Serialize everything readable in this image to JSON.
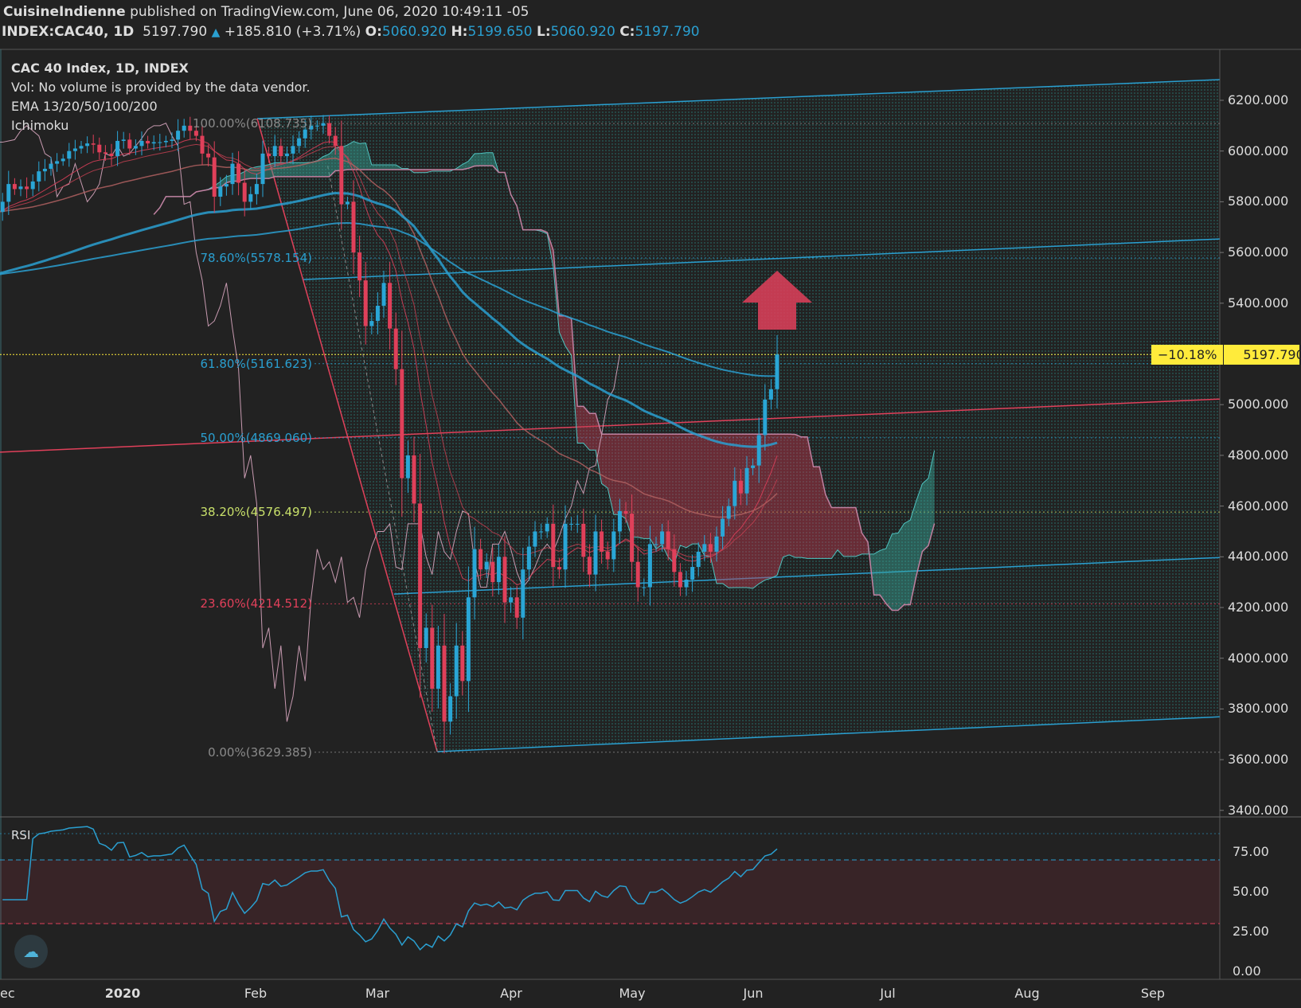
{
  "header": {
    "author": "CuisineIndienne",
    "published": " published on TradingView.com, June 06, 2020 10:49:11 -05",
    "symbol": "INDEX:CAC40, 1D",
    "last": "5197.790",
    "change": "+185.810 (+3.71%)",
    "o_label": "O:",
    "o": "5060.920",
    "h_label": "H:",
    "h": "5199.650",
    "l_label": "L:",
    "l": "5060.920",
    "c_label": "C:",
    "c": "5197.790"
  },
  "legend": [
    "CAC 40 Index, 1D, INDEX",
    "Vol: No volume is provided by the data vendor.",
    "EMA 13/20/50/100/200",
    "Ichimoku"
  ],
  "price_tag": {
    "pct": "−10.18%",
    "price": "5197.790"
  },
  "rsi_label": "RSI",
  "colors": {
    "up": "#2aa6d6",
    "down": "#e0405a",
    "bg": "#222222",
    "tag": "#ffeb3b"
  },
  "chart_data": {
    "type": "candlestick",
    "title": "CAC 40 Index, 1D, INDEX",
    "price_ticks": [
      "6200.000",
      "6000.000",
      "5800.000",
      "5600.000",
      "5400.000",
      "5200.000",
      "5000.000",
      "4800.000",
      "4600.000",
      "4400.000",
      "4200.000",
      "4000.000",
      "3800.000",
      "3600.000",
      "3400.000"
    ],
    "price_range": [
      3400,
      6200
    ],
    "rsi_ticks": [
      "75.00",
      "50.00",
      "25.00",
      "0.00"
    ],
    "rsi_bands": [
      30,
      70
    ],
    "time_ticks": [
      "ec",
      "2020",
      "Feb",
      "Mar",
      "Apr",
      "May",
      "Jun",
      "Jul",
      "Aug",
      "Sep"
    ],
    "fib_levels": [
      {
        "label": "100.00%(6108.735)",
        "value": 6108.735,
        "color": "#8a8a8a"
      },
      {
        "label": "78.60%(5578.154)",
        "value": 5578.154,
        "color": "#2a9fd0"
      },
      {
        "label": "61.80%(5161.623)",
        "value": 5161.623,
        "color": "#2a9fd0"
      },
      {
        "label": "50.00%(4869.060)",
        "value": 4869.06,
        "color": "#2a9fd0"
      },
      {
        "label": "38.20%(4576.497)",
        "value": 4576.497,
        "color": "#c8e06a"
      },
      {
        "label": "23.60%(4214.512)",
        "value": 4214.512,
        "color": "#e0405a"
      },
      {
        "label": "0.00%(3629.385)",
        "value": 3629.385,
        "color": "#8a8a8a"
      }
    ],
    "closes": [
      5760,
      5800,
      5870,
      5850,
      5860,
      5850,
      5880,
      5920,
      5930,
      5950,
      5960,
      5970,
      6000,
      6010,
      6020,
      6030,
      6025,
      5995,
      5990,
      5980,
      6040,
      6045,
      6010,
      6020,
      6040,
      6030,
      6035,
      6035,
      6040,
      6045,
      6080,
      6100,
      6080,
      6060,
      5990,
      5975,
      5820,
      5860,
      5870,
      5950,
      5875,
      5800,
      5830,
      5870,
      5990,
      5980,
      6020,
      5980,
      5990,
      6020,
      6050,
      6085,
      6100,
      6100,
      6110,
      6060,
      6020,
      5790,
      5800,
      5600,
      5490,
      5310,
      5330,
      5390,
      5480,
      5300,
      5140,
      4710,
      4800,
      4610,
      4040,
      4120,
      3880,
      4050,
      3750,
      3850,
      4050,
      3910,
      4240,
      4430,
      4350,
      4380,
      4300,
      4400,
      4220,
      4240,
      4160,
      4350,
      4440,
      4500,
      4500,
      4530,
      4360,
      4350,
      4530,
      4530,
      4530,
      4400,
      4330,
      4500,
      4420,
      4390,
      4500,
      4580,
      4570,
      4380,
      4280,
      4280,
      4450,
      4450,
      4500,
      4430,
      4340,
      4280,
      4310,
      4360,
      4420,
      4450,
      4420,
      4480,
      4550,
      4600,
      4700,
      4650,
      4750,
      4760,
      4880,
      5020,
      5060.92,
      5197.79
    ],
    "ema_periods": [
      13,
      20,
      50,
      100,
      200
    ]
  }
}
